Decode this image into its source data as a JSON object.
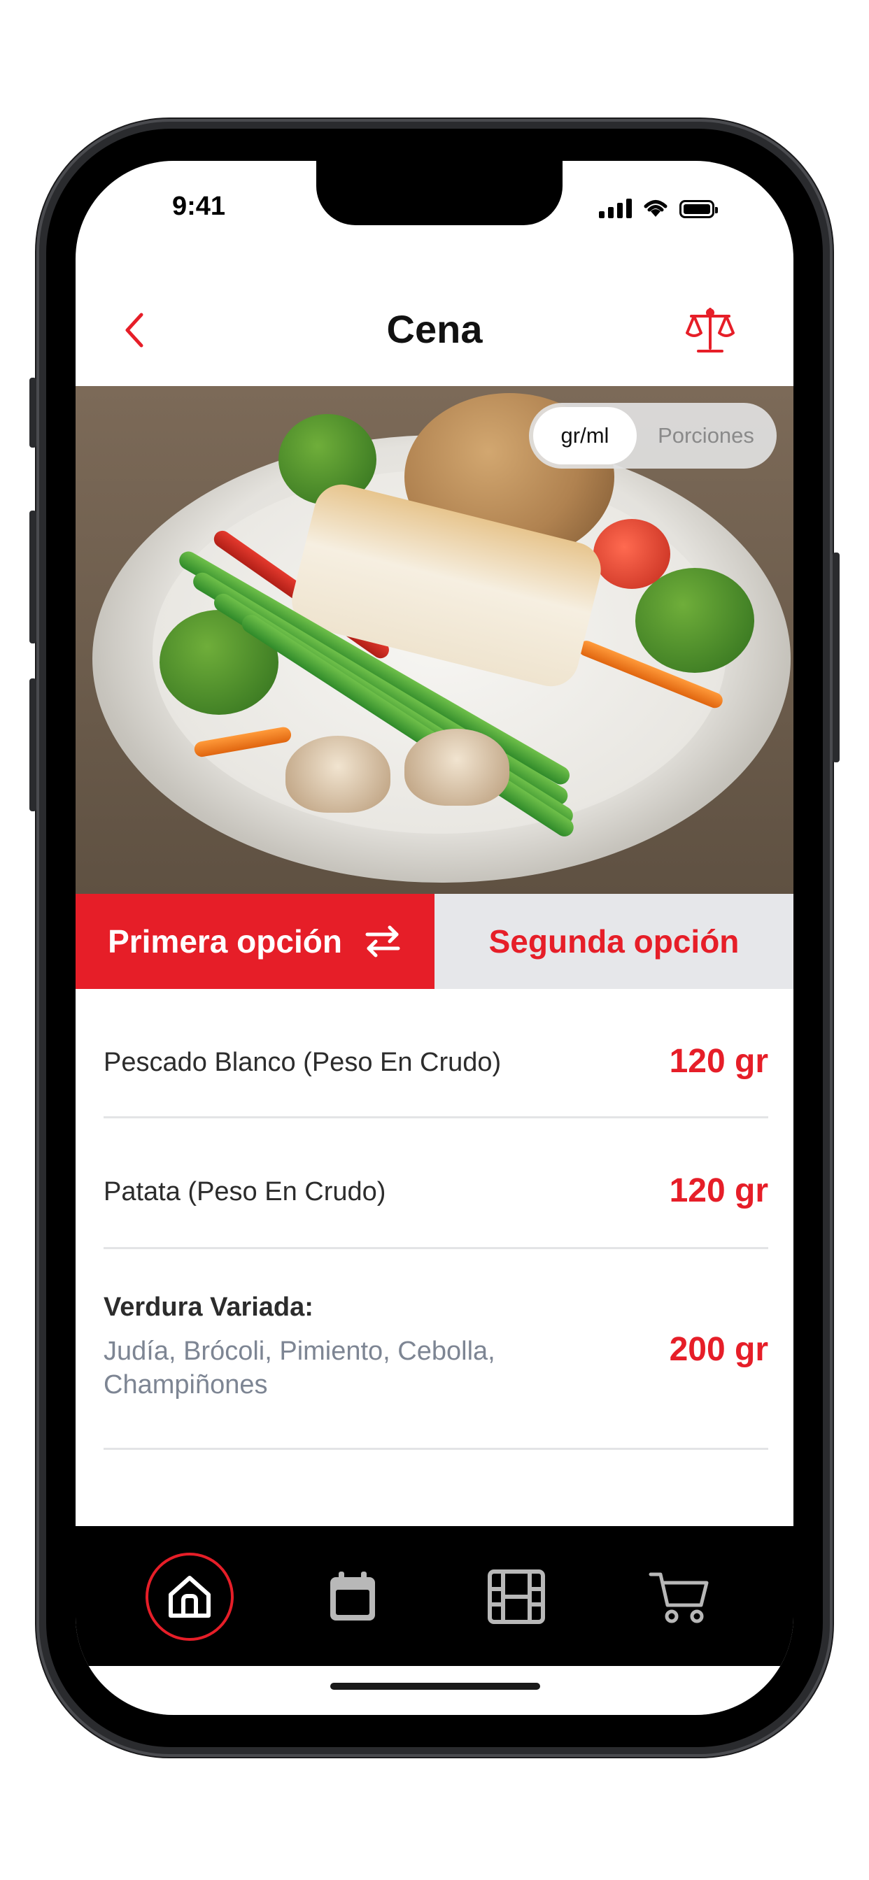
{
  "status_bar": {
    "time": "9:41"
  },
  "header": {
    "title": "Cena"
  },
  "unit_toggle": {
    "options": [
      "gr/ml",
      "Porciones"
    ],
    "selected": "gr/ml"
  },
  "tabs": [
    {
      "label": "Primera opción",
      "active": true
    },
    {
      "label": "Segunda opción",
      "active": false
    }
  ],
  "items": [
    {
      "name": "Pescado Blanco (Peso En Crudo)",
      "quantity": "120 gr"
    },
    {
      "name": "Patata (Peso En Crudo)",
      "quantity": "120 gr"
    },
    {
      "name": "Verdura Variada:",
      "detail": "Judía, Brócoli, Pimiento, Cebolla, Champiñones",
      "quantity": "200 gr"
    }
  ],
  "bottom_nav": [
    {
      "icon": "home-icon",
      "active": true
    },
    {
      "icon": "calendar-icon",
      "active": false
    },
    {
      "icon": "film-icon",
      "active": false
    },
    {
      "icon": "cart-icon",
      "active": false
    }
  ],
  "colors": {
    "accent": "#e61e28",
    "tab_inactive_bg": "#e6e7ea",
    "nav_bg": "#000000"
  }
}
